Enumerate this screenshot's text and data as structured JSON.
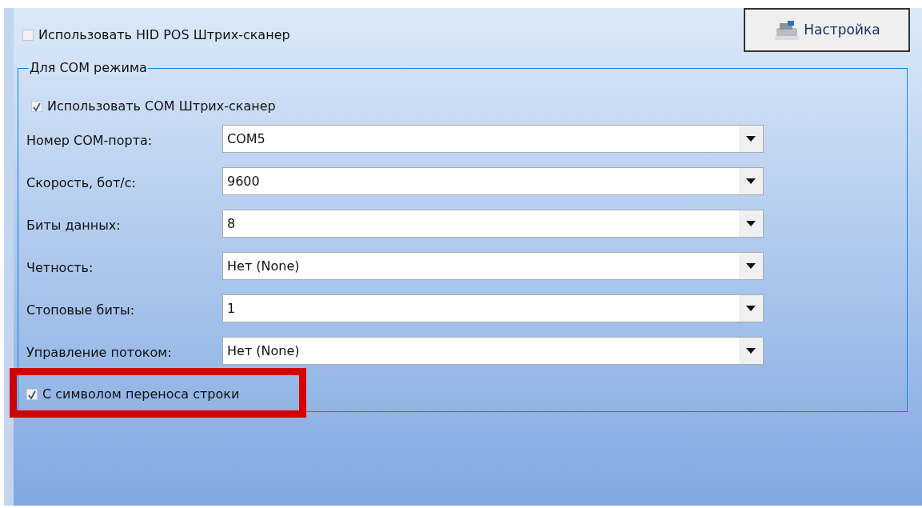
{
  "hid_checkbox": {
    "label": "Использовать HID POS Штрих-сканер",
    "checked": false
  },
  "settings_button": {
    "label": "Настройка"
  },
  "com_group": {
    "title": "Для COM режима",
    "use_checkbox": {
      "label": "Использовать COM Штрих-сканер",
      "checked": true
    },
    "fields": [
      {
        "label": "Номер COM-порта:",
        "value": "COM5"
      },
      {
        "label": "Скорость, бот/с:",
        "value": "9600"
      },
      {
        "label": "Биты данных:",
        "value": "8"
      },
      {
        "label": "Четность:",
        "value": "Нет (None)"
      },
      {
        "label": "Стоповые биты:",
        "value": "1"
      },
      {
        "label": "Управление потоком:",
        "value": "Нет (None)"
      }
    ],
    "newline_checkbox": {
      "label": "С символом переноса строки",
      "checked": true,
      "highlighted": true
    }
  }
}
